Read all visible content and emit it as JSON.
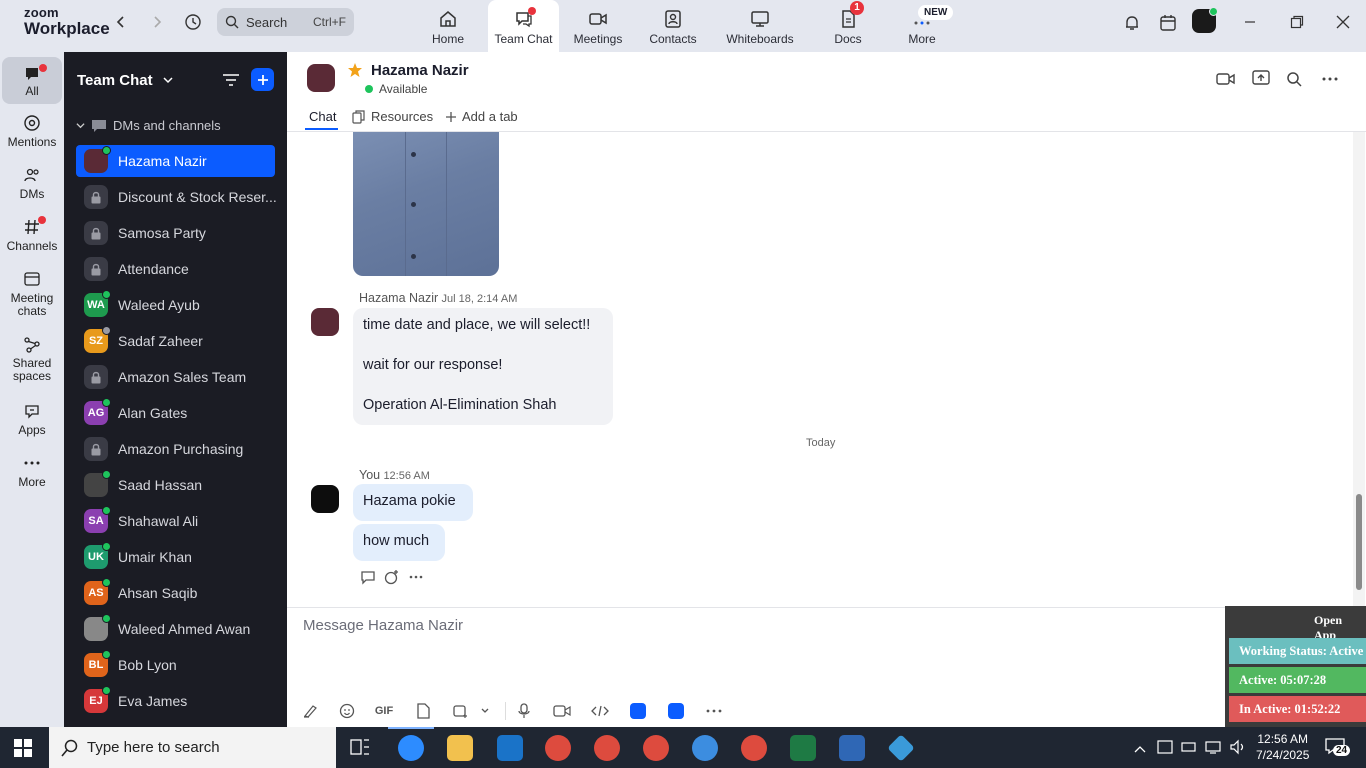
{
  "app": {
    "brand_line1": "zoom",
    "brand_line2": "Workplace"
  },
  "search": {
    "label": "Search",
    "shortcut": "Ctrl+F"
  },
  "top_tabs": [
    {
      "label": "Home"
    },
    {
      "label": "Team Chat"
    },
    {
      "label": "Meetings"
    },
    {
      "label": "Contacts"
    },
    {
      "label": "Whiteboards"
    },
    {
      "label": "Docs",
      "badge": "1"
    },
    {
      "label": "More",
      "badge": "NEW"
    }
  ],
  "rail": [
    {
      "label": "All"
    },
    {
      "label": "Mentions"
    },
    {
      "label": "DMs"
    },
    {
      "label": "Channels"
    },
    {
      "label": "Meeting chats"
    },
    {
      "label": "Shared spaces"
    },
    {
      "label": "Apps"
    },
    {
      "label": "More"
    }
  ],
  "sidebar": {
    "title": "Team Chat",
    "section": "DMs and channels",
    "items": [
      {
        "label": "Hazama Nazir",
        "initials": "",
        "color": "#5a2a36",
        "type": "avatar"
      },
      {
        "label": "Discount & Stock Reser...",
        "type": "lock"
      },
      {
        "label": "Samosa Party",
        "type": "lock"
      },
      {
        "label": "Attendance",
        "type": "lock"
      },
      {
        "label": "Waleed Ayub",
        "initials": "WA",
        "color": "#1e9b4e",
        "type": "initials"
      },
      {
        "label": "Sadaf Zaheer",
        "initials": "SZ",
        "color": "#e89a1c",
        "type": "initials"
      },
      {
        "label": "Amazon Sales Team",
        "type": "lock"
      },
      {
        "label": "Alan Gates",
        "initials": "AG",
        "color": "#8b3fb0",
        "type": "initials"
      },
      {
        "label": "Amazon Purchasing",
        "type": "lock"
      },
      {
        "label": "Saad Hassan",
        "initials": "",
        "color": "#444",
        "type": "photo"
      },
      {
        "label": "Shahawal Ali",
        "initials": "SA",
        "color": "#8b3fb0",
        "type": "initials"
      },
      {
        "label": "Umair Khan",
        "initials": "UK",
        "color": "#1e9b6e",
        "type": "initials"
      },
      {
        "label": "Ahsan Saqib",
        "initials": "AS",
        "color": "#e0641b",
        "type": "initials"
      },
      {
        "label": "Waleed Ahmed Awan",
        "initials": "",
        "color": "#888",
        "type": "photo"
      },
      {
        "label": "Bob Lyon",
        "initials": "BL",
        "color": "#e0641b",
        "type": "initials"
      },
      {
        "label": "Eva James",
        "initials": "EJ",
        "color": "#d6383a",
        "type": "initials"
      }
    ]
  },
  "chat_header": {
    "name": "Hazama Nazir",
    "status": "Available"
  },
  "chat_tabs": {
    "chat": "Chat",
    "resources": "Resources",
    "add": "Add a tab"
  },
  "messages": {
    "m1_sender": "Hazama Nazir",
    "m1_time": "Jul 18, 2:14 AM",
    "m1_lines": [
      "time date and place, we will select!!",
      "wait for our response!",
      "Operation Al-Elimination Shah"
    ],
    "divider": "Today",
    "m2_sender": "You",
    "m2_time": "12:56 AM",
    "m2_lines": [
      "Hazama pokie",
      "how much"
    ]
  },
  "composer": {
    "placeholder": "Message Hazama Nazir",
    "gif": "GIF"
  },
  "widget": {
    "open": "Open App",
    "working": "Working Status: Active",
    "active": "Active: 05:07:28",
    "inactive": "In Active: 01:52:22"
  },
  "taskbar": {
    "search": "Type here to search",
    "time": "12:56 AM",
    "date": "7/24/2025",
    "notif": "24"
  },
  "colors": {
    "accent": "#0b5cff",
    "presence": "#1ec45c",
    "badge": "#e8333c"
  }
}
